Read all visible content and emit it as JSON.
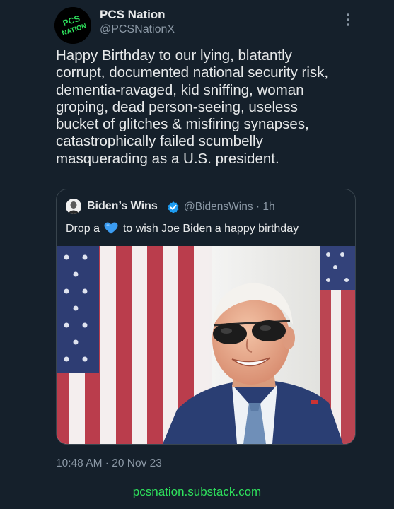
{
  "author": {
    "display_name": "PCS Nation",
    "handle": "@PCSNationX",
    "avatar_text": "PCS NATION",
    "avatar_color": "#2ee05c"
  },
  "tweet": {
    "text": "Happy Birthday to our lying, blatantly\ncorrupt, documented national security risk,\ndementia-ravaged, kid sniffing, woman\ngroping, dead person-seeing, useless\nbucket of glitches & misfiring synapses,\ncatastrophically failed scumbelly\nmasquerading as a U.S. president.",
    "timestamp": "10:48 AM · 20 Nov 23"
  },
  "quoted_tweet": {
    "display_name": "Biden’s Wins",
    "handle_time": "@BidensWins · 1h",
    "text_before": "Drop a",
    "emoji": "blue-heart",
    "text_after": "to wish Joe Biden a happy birthday",
    "verified_color": "#1d9bf0",
    "image_icon": "photo-of-smiling-man-in-sunglasses-before-american-flag"
  },
  "more_icon": "three-dots-vertical",
  "watermark": "pcsnation.substack.com",
  "colors": {
    "background": "#15202b",
    "text_primary": "#e7e9ea",
    "text_secondary": "#8b98a5",
    "border": "#38444d",
    "accent_green": "#2ee05c",
    "heart_blue": "#3b9cf2"
  }
}
